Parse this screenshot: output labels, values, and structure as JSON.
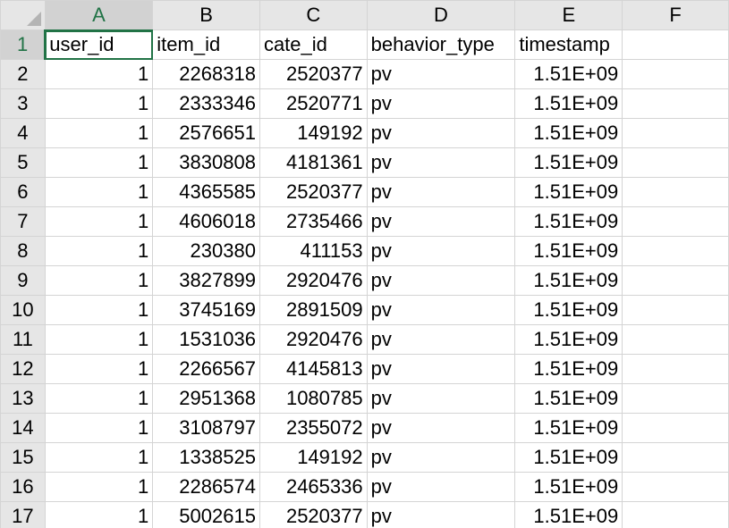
{
  "sheet": {
    "columns": [
      "A",
      "B",
      "C",
      "D",
      "E",
      "F"
    ],
    "active_column": "A",
    "active_row": "1",
    "header_row": {
      "row_number": "1",
      "cells": [
        "user_id",
        "item_id",
        "cate_id",
        "behavior_type",
        "timestamp",
        ""
      ]
    },
    "rows": [
      {
        "row_number": "2",
        "cells": [
          "1",
          "2268318",
          "2520377",
          "pv",
          "1.51E+09",
          ""
        ]
      },
      {
        "row_number": "3",
        "cells": [
          "1",
          "2333346",
          "2520771",
          "pv",
          "1.51E+09",
          ""
        ]
      },
      {
        "row_number": "4",
        "cells": [
          "1",
          "2576651",
          "149192",
          "pv",
          "1.51E+09",
          ""
        ]
      },
      {
        "row_number": "5",
        "cells": [
          "1",
          "3830808",
          "4181361",
          "pv",
          "1.51E+09",
          ""
        ]
      },
      {
        "row_number": "6",
        "cells": [
          "1",
          "4365585",
          "2520377",
          "pv",
          "1.51E+09",
          ""
        ]
      },
      {
        "row_number": "7",
        "cells": [
          "1",
          "4606018",
          "2735466",
          "pv",
          "1.51E+09",
          ""
        ]
      },
      {
        "row_number": "8",
        "cells": [
          "1",
          "230380",
          "411153",
          "pv",
          "1.51E+09",
          ""
        ]
      },
      {
        "row_number": "9",
        "cells": [
          "1",
          "3827899",
          "2920476",
          "pv",
          "1.51E+09",
          ""
        ]
      },
      {
        "row_number": "10",
        "cells": [
          "1",
          "3745169",
          "2891509",
          "pv",
          "1.51E+09",
          ""
        ]
      },
      {
        "row_number": "11",
        "cells": [
          "1",
          "1531036",
          "2920476",
          "pv",
          "1.51E+09",
          ""
        ]
      },
      {
        "row_number": "12",
        "cells": [
          "1",
          "2266567",
          "4145813",
          "pv",
          "1.51E+09",
          ""
        ]
      },
      {
        "row_number": "13",
        "cells": [
          "1",
          "2951368",
          "1080785",
          "pv",
          "1.51E+09",
          ""
        ]
      },
      {
        "row_number": "14",
        "cells": [
          "1",
          "3108797",
          "2355072",
          "pv",
          "1.51E+09",
          ""
        ]
      },
      {
        "row_number": "15",
        "cells": [
          "1",
          "1338525",
          "149192",
          "pv",
          "1.51E+09",
          ""
        ]
      },
      {
        "row_number": "16",
        "cells": [
          "1",
          "2286574",
          "2465336",
          "pv",
          "1.51E+09",
          ""
        ]
      },
      {
        "row_number": "17",
        "cells": [
          "1",
          "5002615",
          "2520377",
          "pv",
          "1.51E+09",
          ""
        ]
      }
    ]
  }
}
